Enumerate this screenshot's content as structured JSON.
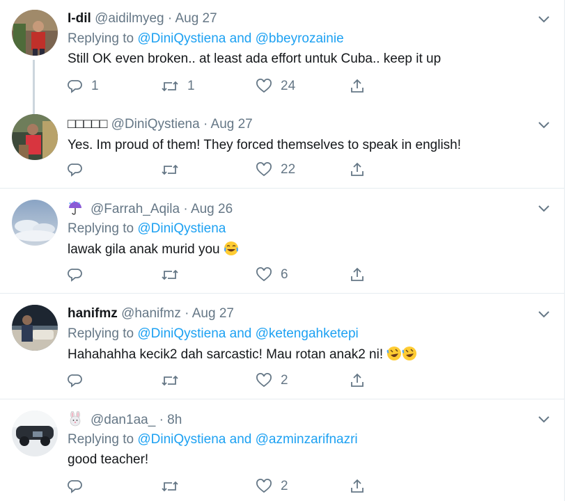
{
  "tweets": [
    {
      "name": "I-dil",
      "handle": "@aidilmyeg",
      "time": "Aug 27",
      "replying_prefix": "Replying to",
      "mentions": [
        "@DiniQystiena",
        "@bbeyrozainie"
      ],
      "joiner": "and",
      "text": "Still OK even broken.. at least ada effort untuk Cuba.. keep it up",
      "replies": "1",
      "retweets": "1",
      "likes": "24"
    },
    {
      "name": "",
      "name_glyphs": "□□□□□",
      "handle": "@DiniQystiena",
      "time": "Aug 27",
      "text": "Yes. Im proud of them! They forced themselves to speak in english!",
      "replies": "",
      "retweets": "",
      "likes": "22"
    },
    {
      "name_emoji": "umbrella-with-rain",
      "handle": "@Farrah_Aqila",
      "time": "Aug 26",
      "replying_prefix": "Replying to",
      "mentions": [
        "@DiniQystiena"
      ],
      "text": "lawak gila anak murid you",
      "text_emoji": "face-with-tears-of-joy",
      "replies": "",
      "retweets": "",
      "likes": "6"
    },
    {
      "name": "hanifmz",
      "handle": "@hanifmz",
      "time": "Aug 27",
      "replying_prefix": "Replying to",
      "mentions": [
        "@DiniQystiena",
        "@ketengahketepi"
      ],
      "joiner": "and",
      "text": "Hahahahha kecik2 dah sarcastic! Mau rotan anak2 ni!",
      "text_emoji": "rolling-on-floor-laughing x2",
      "replies": "",
      "retweets": "",
      "likes": "2"
    },
    {
      "name_emoji": "rabbit-face",
      "handle": "@dan1aa_",
      "time": "8h",
      "replying_prefix": "Replying to",
      "mentions": [
        "@DiniQystiena",
        "@azminzarifnazri"
      ],
      "joiner": "and",
      "text": "good teacher!",
      "replies": "",
      "retweets": "",
      "likes": "2"
    }
  ],
  "separator": "·",
  "colors": {
    "link": "#1da1f2",
    "secondary": "#657786",
    "text": "#14171a",
    "divider": "#e6ecf0"
  }
}
